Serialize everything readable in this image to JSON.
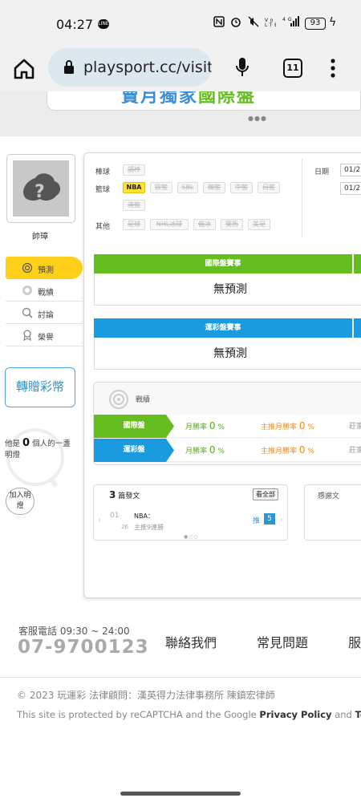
{
  "status_bar": {
    "time": "04:27",
    "app_badge": "LINE",
    "battery": "93"
  },
  "browser": {
    "url": "playsport.cc/visit",
    "tab_count": "11"
  },
  "banner": {
    "text_blue": "賣月獨家",
    "text_green": "國際盤"
  },
  "profile": {
    "username": "帥璋"
  },
  "sidebar": {
    "items": [
      {
        "label": "預測"
      },
      {
        "label": "戰績"
      },
      {
        "label": "討論"
      },
      {
        "label": "榮譽"
      }
    ],
    "gift_button": "轉贈彩幣",
    "bulb": {
      "prefix": "他是",
      "count": "0",
      "suffix": "個人的一盞明燈"
    },
    "add_light": "加入明燈"
  },
  "filters": {
    "baseball_label": "棒球",
    "baseball_chips": [
      "讀棒"
    ],
    "basketball_label": "籃球",
    "basketball_chips": [
      "NBA",
      "歐籃",
      "SBL",
      "韓籃",
      "中籃",
      "日籃",
      "澳籃"
    ],
    "other_label": "其他",
    "other_chips": [
      "足球",
      "NHL冰球",
      "俄冰",
      "賽馬",
      "美足"
    ],
    "date_label": "日期",
    "date_values": [
      "01/2",
      "01/2"
    ]
  },
  "sections": {
    "intl": {
      "header": "國際盤賽事",
      "body": "無預測",
      "color": "#65bd1f"
    },
    "lottery": {
      "header": "運彩盤賽事",
      "body": "無預測",
      "color": "#1a9be0"
    }
  },
  "record": {
    "title": "戰績",
    "rows": [
      {
        "tag": "國際盤",
        "c1_label": "月勝率",
        "c1_value": "0",
        "c2_label": "主推月勝率",
        "c2_value": "0",
        "c3": "莊家",
        "unit": "%"
      },
      {
        "tag": "運彩盤",
        "c1_label": "月勝率",
        "c1_value": "0",
        "c2_label": "主推月勝率",
        "c2_value": "0",
        "c3": "莊家",
        "unit": "%"
      }
    ]
  },
  "hot_posts": {
    "count": "3",
    "label": "篇發文",
    "view_all": "看全部",
    "date_top": "01",
    "date_bottom": "26",
    "post_title": "NBA：",
    "post_sub": "主推9連勝",
    "push_label": "推",
    "push_count": "5"
  },
  "thanks": {
    "header": "感謝文"
  },
  "footer": {
    "tel_label": "客服電話 09:30 ~ 24:00",
    "tel": "07-9700123",
    "links": [
      "聯絡我們",
      "常見問題",
      "服務"
    ],
    "copyright": "© 2023 玩運彩 法律顧問：漢英得力法律事務所 陳鎮宏律師",
    "recaptcha_prefix": "This site is protected by reCAPTCHA and the Google",
    "privacy": "Privacy Policy",
    "and": "and",
    "terms": "Te"
  }
}
